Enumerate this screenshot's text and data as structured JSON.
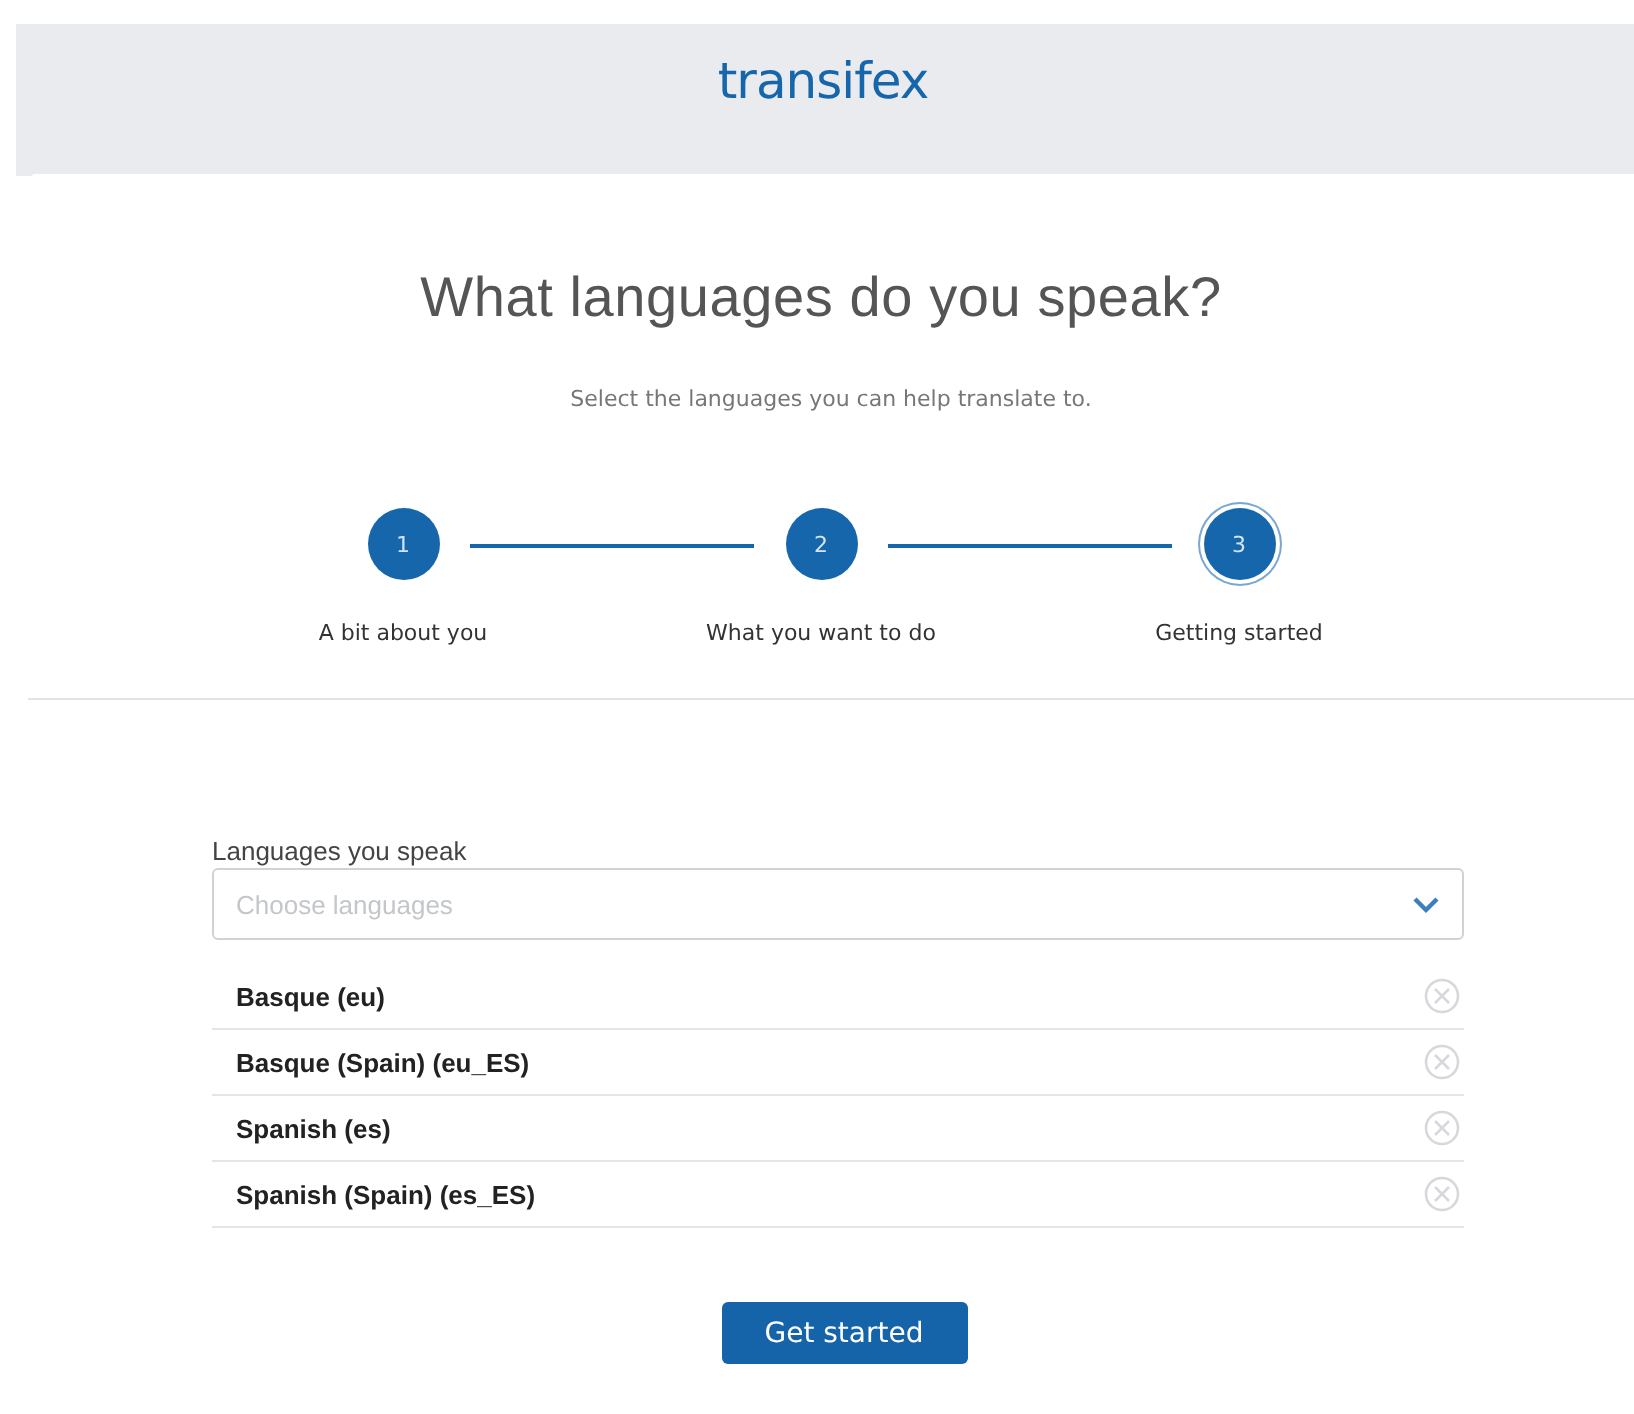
{
  "header": {
    "logo": "transifex"
  },
  "title": "What languages do you speak?",
  "subtitle": "Select the languages you can help translate to.",
  "steps": [
    {
      "number": "1",
      "label": "A bit about you",
      "selected": false
    },
    {
      "number": "2",
      "label": "What you want to do",
      "selected": false
    },
    {
      "number": "3",
      "label": "Getting started",
      "selected": true
    }
  ],
  "languages_field": {
    "label": "Languages you speak",
    "placeholder": "Choose languages"
  },
  "selected_languages": [
    {
      "name": "Basque (eu)"
    },
    {
      "name": "Basque (Spain) (eu_ES)"
    },
    {
      "name": "Spanish (es)"
    },
    {
      "name": "Spanish (Spain) (es_ES)"
    }
  ],
  "submit_button": "Get started"
}
